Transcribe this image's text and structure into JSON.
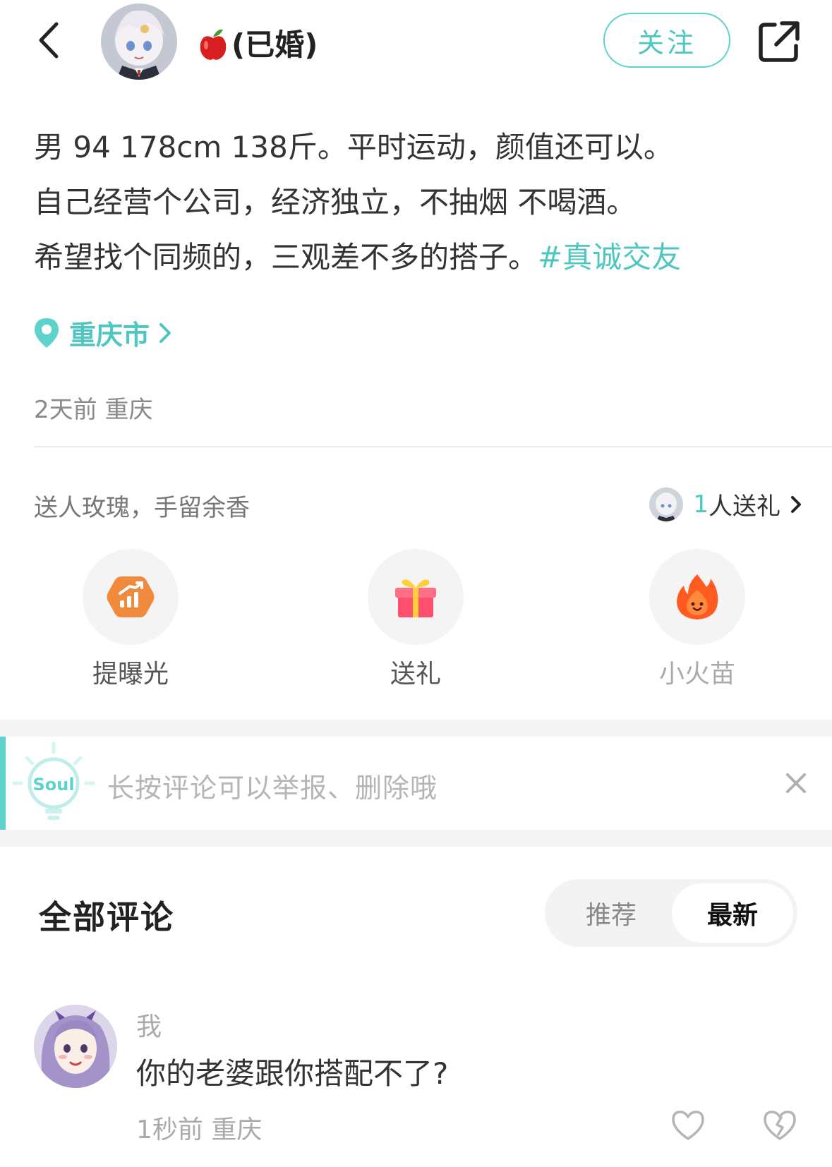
{
  "header": {
    "username": "(已婚)",
    "username_emoji": "apple-icon",
    "follow_label": "关注"
  },
  "post": {
    "lines": [
      "男 94 178cm 138斤。平时运动，颜值还可以。",
      "自己经营个公司，经济独立，不抽烟 不喝酒。",
      "希望找个同频的，三观差不多的搭子。"
    ],
    "hashtag": "#真诚交友",
    "location": "重庆市",
    "meta": "2天前  重庆"
  },
  "gifts": {
    "caption": "送人玫瑰，手留余香",
    "count_num": "1",
    "count_text": "人送礼"
  },
  "actions": [
    {
      "label": "提曝光",
      "icon": "boost-icon"
    },
    {
      "label": "送礼",
      "icon": "gift-icon"
    },
    {
      "label": "小火苗",
      "icon": "flame-icon"
    }
  ],
  "tip": {
    "logo_text": "Soul",
    "text": "长按评论可以举报、删除哦"
  },
  "comments": {
    "title": "全部评论",
    "sort_options": [
      "推荐",
      "最新"
    ],
    "selected": "最新",
    "items": [
      {
        "author": "我",
        "text": "你的老婆跟你搭配不了?",
        "meta": "1秒前  重庆"
      }
    ]
  },
  "colors": {
    "accent": "#4fc7c0",
    "text": "#333333",
    "muted": "#aaaaaa"
  }
}
